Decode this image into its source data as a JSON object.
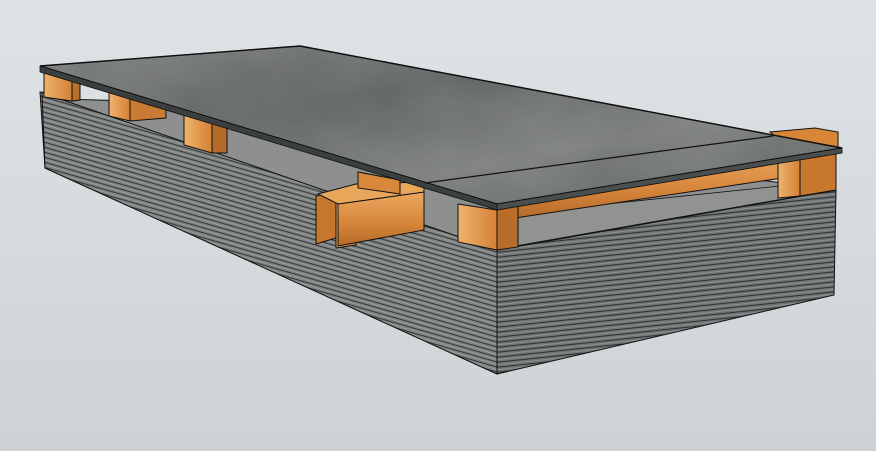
{
  "scene": {
    "subject": "sheet-metal-stack-with-wooden-dunnage-and-top-plate",
    "colors": {
      "background": "#d7dcdf",
      "steel_light": "#a7a9a8",
      "steel_mid": "#7f8281",
      "steel_dark": "#55595a",
      "wood_light": "#e7a45a",
      "wood_mid": "#cf7f33",
      "wood_dark": "#a85f22",
      "edge": "#111111"
    },
    "elements": [
      "top-plate",
      "lower-sheet-stack",
      "wooden-spacers",
      "wooden-long-beam"
    ]
  }
}
